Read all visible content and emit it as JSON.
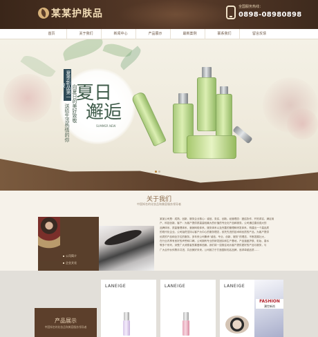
{
  "header": {
    "logo_text": "某某护肤品",
    "hotline_label": "全国服务热线：",
    "hotline_number": "0898-08980898"
  },
  "nav": {
    "items": [
      "首页",
      "关于我们",
      "新闻中心",
      "产品展示",
      "最新案例",
      "联系我们",
      "留言反馈"
    ]
  },
  "banner": {
    "tag": "夏季新品第一波",
    "subtitle_1": "向夏日的美好致敬",
    "subtitle_2": "送给生活热情的你",
    "title_1": "夏日",
    "title_2": "邂逅",
    "english": "SUMMER NEW",
    "slide_count": 2,
    "active_slide": 1
  },
  "about": {
    "title": "关于我们",
    "subtitle": "中国知名的化妆品和美容服务领导者",
    "links": [
      "公司简介",
      "企业文化"
    ],
    "more_button": "查看详情",
    "text_lines": [
      "某某公司是：成熟、创新、服务企业核心：诚信、务实、创新。经营理念：团结协作、开拓求实、满足用",
      "户、科技创新。客户：为客户提供质高量轻最大的价值的专业化产品和服务。公司通过建设强大的",
      "品牌体系、质量管理体系、营销网络体系、服务体系以及完善的管理和研发体系，构建出一个高品质",
      "的现代化企业。公司始终坚持以客户为中心的服务理念，依托先进的技术和优质的产品，为客户提供",
      "优质的产品和全方位的服务。多年来公司秉承“诚信、专业、创新、服务”的理念，不断发展壮大，",
      "在行业内享有良好的声誉和口碑。公司拥有专业的研发团队和生产基地，产品涵盖护肤、彩妆、香水",
      "等多个系列，深受广大消费者的喜爱和信赖。我们将一如既往地为客户提供更好的产品与服务，与",
      "广大合作伙伴携手共进，共创美好未来。公司致力于打造国际知名品牌，追求卓越品质……"
    ]
  },
  "products": {
    "title": "产品展示",
    "subtitle": "中国知名的化妆品和美容服务领导者",
    "cards": [
      {
        "brand": "LANEIGE"
      },
      {
        "brand": "LANEIGE"
      },
      {
        "brand": "LANEIGE"
      }
    ],
    "fashion_label": "FASHION",
    "fashion_sub": "潮世新尚"
  },
  "colors": {
    "header_brown": "#4a3222",
    "accent_orange": "#d18a2e",
    "banner_green": "#3d5a48"
  }
}
